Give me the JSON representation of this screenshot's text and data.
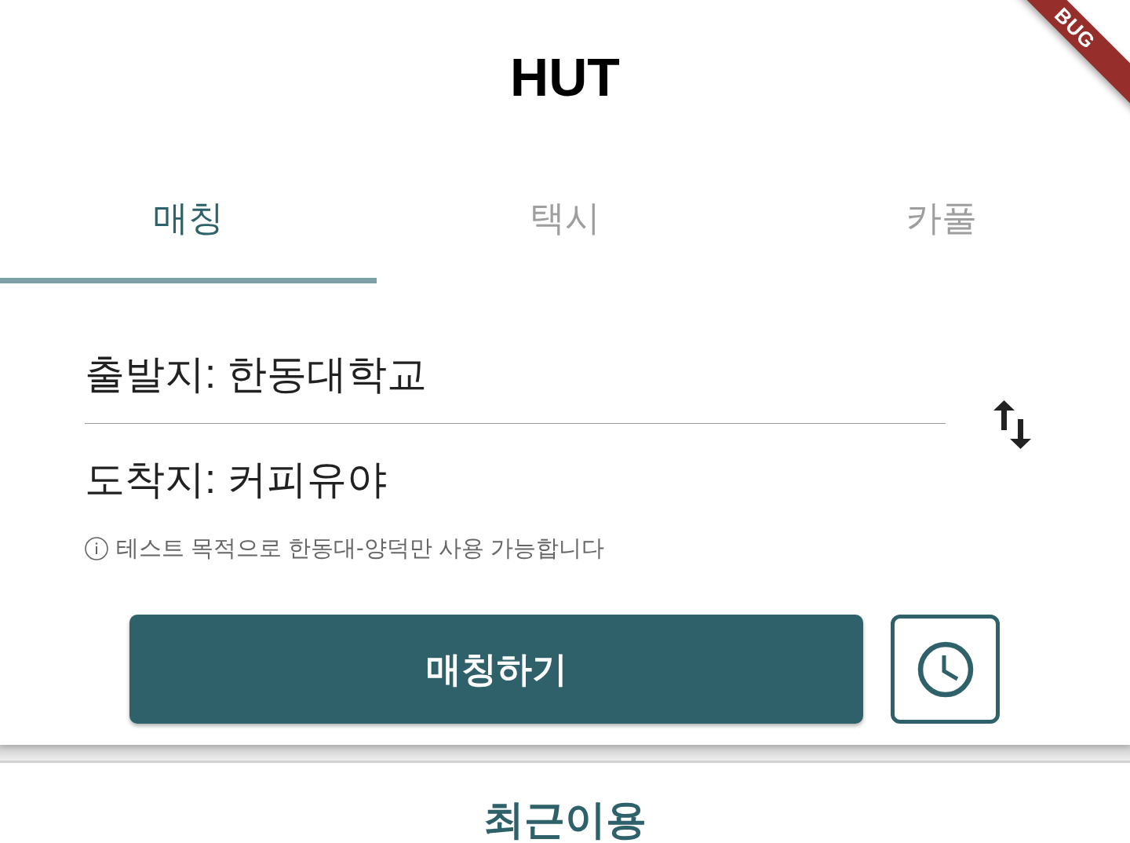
{
  "app_bar": {
    "title": "HUT"
  },
  "debug_banner": {
    "text": "BUG"
  },
  "tabs": [
    {
      "label": "매칭",
      "selected": true
    },
    {
      "label": "택시",
      "selected": false
    },
    {
      "label": "카풀",
      "selected": false
    }
  ],
  "route": {
    "departure": "출발지: 한동대학교",
    "arrival": "도착지: 커피유야"
  },
  "notice": "테스트 목적으로 한동대-양덕만 사용 가능합니다",
  "actions": {
    "primary": "매칭하기"
  },
  "recent": {
    "title": "최근이용"
  }
}
